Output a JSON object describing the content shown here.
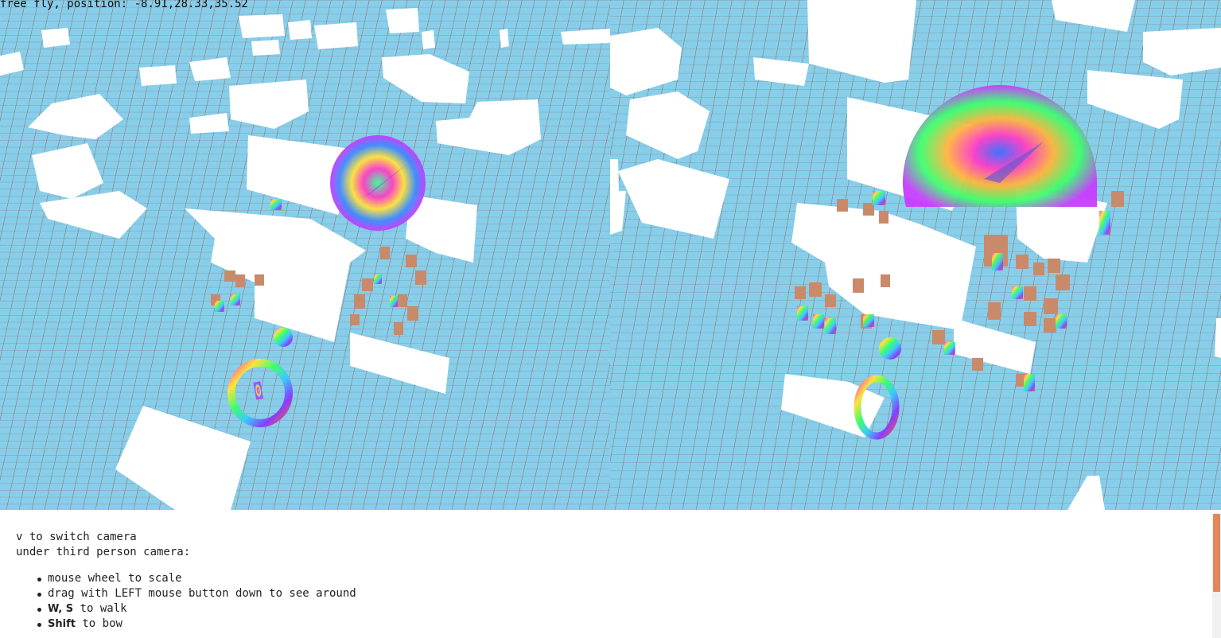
{
  "hud": {
    "position_readout": "free fly, position: -8.91,28.33,35.52"
  },
  "instructions": {
    "switch_camera": "v to switch camera",
    "third_person_heading": "under third person camera:",
    "items": [
      {
        "key": "",
        "text": "mouse wheel to scale"
      },
      {
        "key": "",
        "text": "drag with LEFT mouse button down to see around"
      },
      {
        "key": "W, S",
        "text": " to walk"
      },
      {
        "key": "Shift",
        "text": " to bow"
      }
    ]
  },
  "colors": {
    "ground": "#87ceeb",
    "grid_line": "#8c6a5a",
    "building": "#ffffff",
    "crate": "#c98a6a",
    "scrollbar_thumb": "#e5865a"
  },
  "scene": {
    "left_view": "free-fly-camera",
    "right_view": "third-person-camera"
  }
}
